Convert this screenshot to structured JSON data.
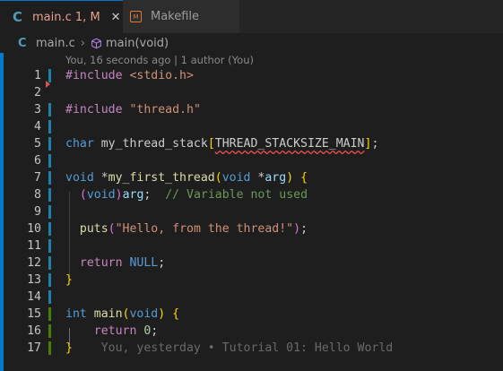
{
  "tabs": [
    {
      "icon": "C",
      "label": "main.c",
      "status": "1, M",
      "close": "✕",
      "active": true
    },
    {
      "icon": "makefile-icon",
      "label": "Makefile",
      "active": false
    }
  ],
  "breadcrumb": {
    "file": "main.c",
    "separator": "›",
    "symbol": "main(void)"
  },
  "blame_header": "You, 16 seconds ago | 1 author (You)",
  "code": {
    "line_numbers": [
      "1",
      "2",
      "3",
      "4",
      "5",
      "6",
      "7",
      "8",
      "9",
      "10",
      "11",
      "12",
      "13",
      "14",
      "15",
      "16",
      "17"
    ],
    "l1_include": "#include",
    "l1_header": "<stdio.h>",
    "l3_include": "#include",
    "l3_header": "\"thread.h\"",
    "l5_type": "char",
    "l5_name": " my_thread_stack",
    "l5_open": "[",
    "l5_const": "THREAD_STACKSIZE_MAIN",
    "l5_close": "]",
    "l5_end": ";",
    "l7_type": "void",
    "l7_star": " *",
    "l7_fn": "my_first_thread",
    "l7_open": "(",
    "l7_ptype": "void",
    "l7_pstar": " *",
    "l7_param": "arg",
    "l7_close": ")",
    "l7_brace": " {",
    "l8_open": "(",
    "l8_type": "void",
    "l8_close": ")",
    "l8_var": "arg",
    "l8_semi": ";  ",
    "l8_comment": "// Variable not used",
    "l10_fn": "puts",
    "l10_open": "(",
    "l10_str": "\"Hello, from the thread!\"",
    "l10_close": ")",
    "l10_semi": ";",
    "l12_kw": "return",
    "l12_null": " NULL",
    "l12_semi": ";",
    "l13_brace": "}",
    "l15_type": "int",
    "l15_fn": " main",
    "l15_open": "(",
    "l15_ptype": "void",
    "l15_close": ")",
    "l15_brace": " {",
    "l16_kw": "return",
    "l16_num": " 0",
    "l16_semi": ";",
    "l17_brace": "}",
    "l17_blame": "    You, yesterday • Tutorial 01: Hello World"
  },
  "colors": {
    "accent": "#007acc",
    "modified_gutter": "#1b81a8",
    "added_gutter": "#487e02",
    "deleted_marker": "#e05252"
  }
}
